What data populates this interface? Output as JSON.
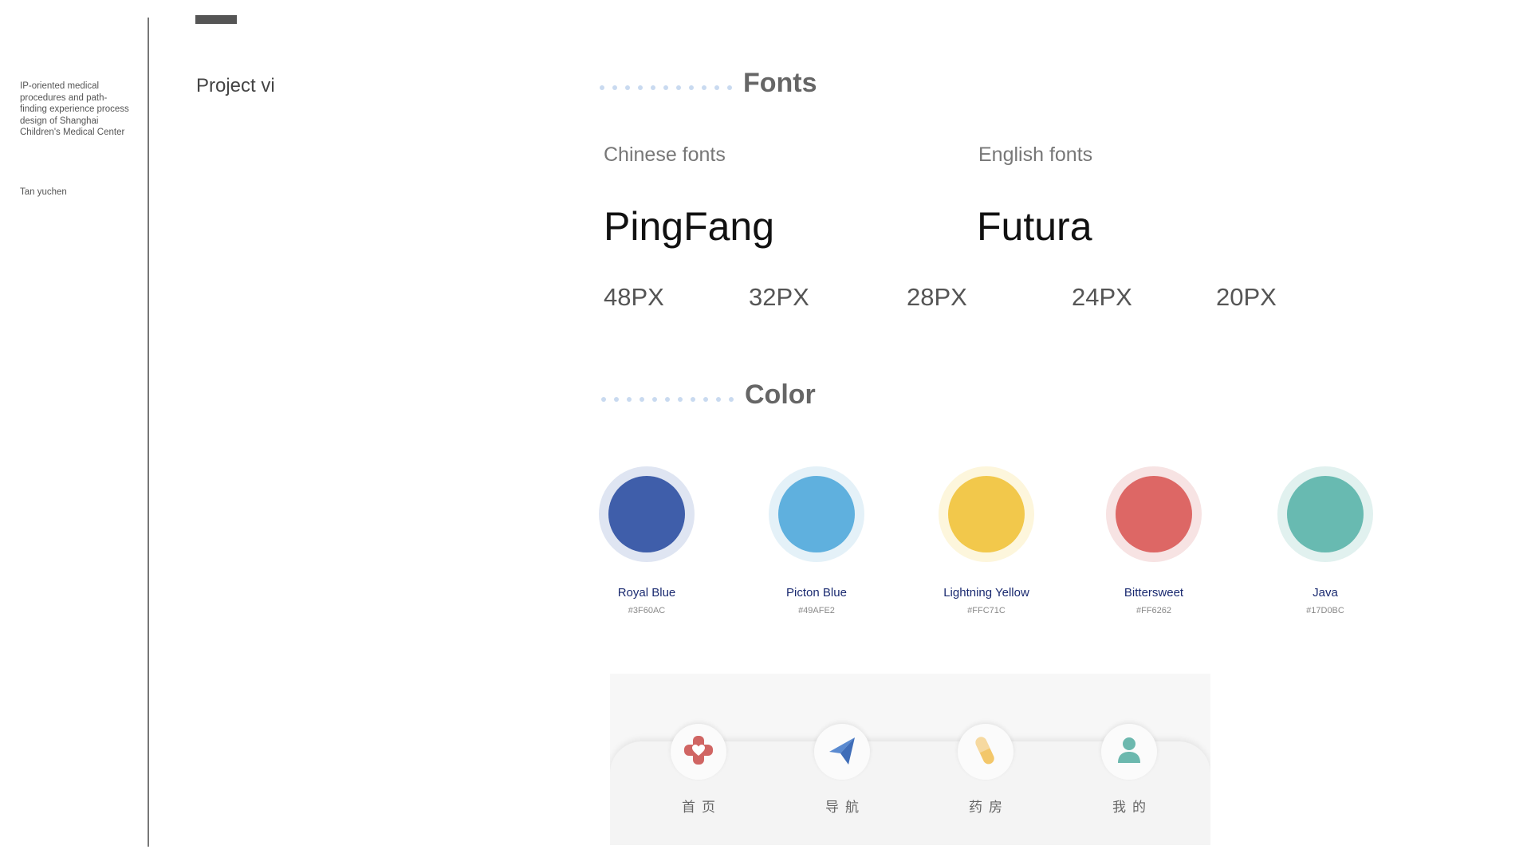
{
  "sidebar": {
    "description": "IP-oriented medical procedures and path-finding experience process design of Shanghai Children's Medical Center",
    "author": "Tan yuchen"
  },
  "project_title": "Project vi",
  "fonts_section": {
    "title": "Fonts",
    "chinese_label": "Chinese fonts",
    "chinese_sample": "PingFang",
    "english_label": "English fonts",
    "english_sample": "Futura",
    "sizes": [
      "48PX",
      "32PX",
      "28PX",
      "24PX",
      "20PX"
    ]
  },
  "color_section": {
    "title": "Color",
    "swatches": [
      {
        "name": "Royal Blue",
        "hex": "#3F60AC",
        "ring": "#dfe5f2",
        "core": "#3f5eaa"
      },
      {
        "name": "Picton Blue",
        "hex": "#49AFE2",
        "ring": "#e4f1f8",
        "core": "#5fb0de"
      },
      {
        "name": "Lightning Yellow",
        "hex": "#FFC71C",
        "ring": "#fdf6dc",
        "core": "#f2c84b"
      },
      {
        "name": "Bittersweet",
        "hex": "#FF6262",
        "ring": "#f7e3e3",
        "core": "#dd6765"
      },
      {
        "name": "Java",
        "hex": "#17D0BC",
        "ring": "#e1f1ef",
        "core": "#68bab1"
      }
    ]
  },
  "tabbar": {
    "tabs": [
      {
        "label": "首页",
        "icon": "medical-cross-heart-icon"
      },
      {
        "label": "导航",
        "icon": "paper-plane-icon"
      },
      {
        "label": "药房",
        "icon": "pill-capsule-icon"
      },
      {
        "label": "我的",
        "icon": "user-profile-icon"
      }
    ]
  }
}
